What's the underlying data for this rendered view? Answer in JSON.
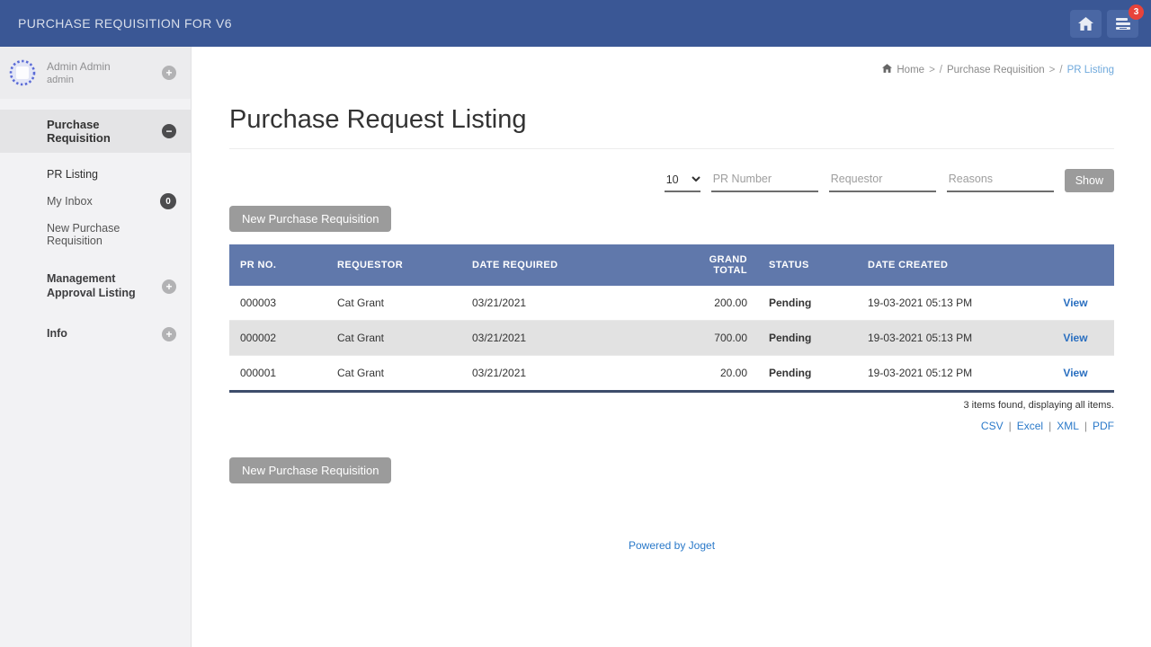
{
  "topbar": {
    "title": "PURCHASE REQUISITION FOR V6",
    "inbox_badge": "3"
  },
  "sidebar": {
    "user": {
      "name": "Admin Admin",
      "username": "admin"
    },
    "menu_header": {
      "label": "Purchase Requisition"
    },
    "items": [
      {
        "label": "PR Listing"
      },
      {
        "label": "My Inbox",
        "badge": "0"
      },
      {
        "label": "New Purchase Requisition"
      }
    ],
    "sections": [
      {
        "label": "Management Approval Listing"
      },
      {
        "label": "Info"
      }
    ]
  },
  "breadcrumb": {
    "items": [
      "Home",
      "Purchase Requisition",
      "PR Listing"
    ],
    "arrow": ">",
    "slash": "/"
  },
  "page": {
    "title": "Purchase Request Listing"
  },
  "filters": {
    "page_size": "10",
    "pr_number_placeholder": "PR Number",
    "requestor_placeholder": "Requestor",
    "reasons_placeholder": "Reasons",
    "show_label": "Show"
  },
  "actions": {
    "new_pr_label": "New Purchase Requisition"
  },
  "table": {
    "headers": {
      "pr_no": "PR NO.",
      "requestor": "REQUESTOR",
      "date_required": "DATE REQUIRED",
      "grand_total": "GRAND TOTAL",
      "status": "STATUS",
      "date_created": "DATE CREATED"
    },
    "rows": [
      {
        "pr_no": "000003",
        "requestor": "Cat Grant",
        "date_required": "03/21/2021",
        "grand_total": "200.00",
        "status": "Pending",
        "date_created": "19-03-2021 05:13 PM",
        "action": "View"
      },
      {
        "pr_no": "000002",
        "requestor": "Cat Grant",
        "date_required": "03/21/2021",
        "grand_total": "700.00",
        "status": "Pending",
        "date_created": "19-03-2021 05:13 PM",
        "action": "View"
      },
      {
        "pr_no": "000001",
        "requestor": "Cat Grant",
        "date_required": "03/21/2021",
        "grand_total": "20.00",
        "status": "Pending",
        "date_created": "19-03-2021 05:12 PM",
        "action": "View"
      }
    ],
    "summary": "3 items found, displaying all items.",
    "export_links": [
      "CSV",
      "Excel",
      "XML",
      "PDF"
    ],
    "export_separator": "|"
  },
  "footer": {
    "powered_by": "Powered by Joget"
  },
  "colors": {
    "topbar": "#3a5795",
    "topbar_button": "#4a67a4",
    "badge": "#e8433a",
    "table_header": "#6078ab",
    "link": "#2a79c9",
    "view_link": "#2a6fc0",
    "button_gray": "#9b9b9b",
    "alt_row": "#e2e2e2",
    "sidebar_bg": "#f2f2f4"
  }
}
